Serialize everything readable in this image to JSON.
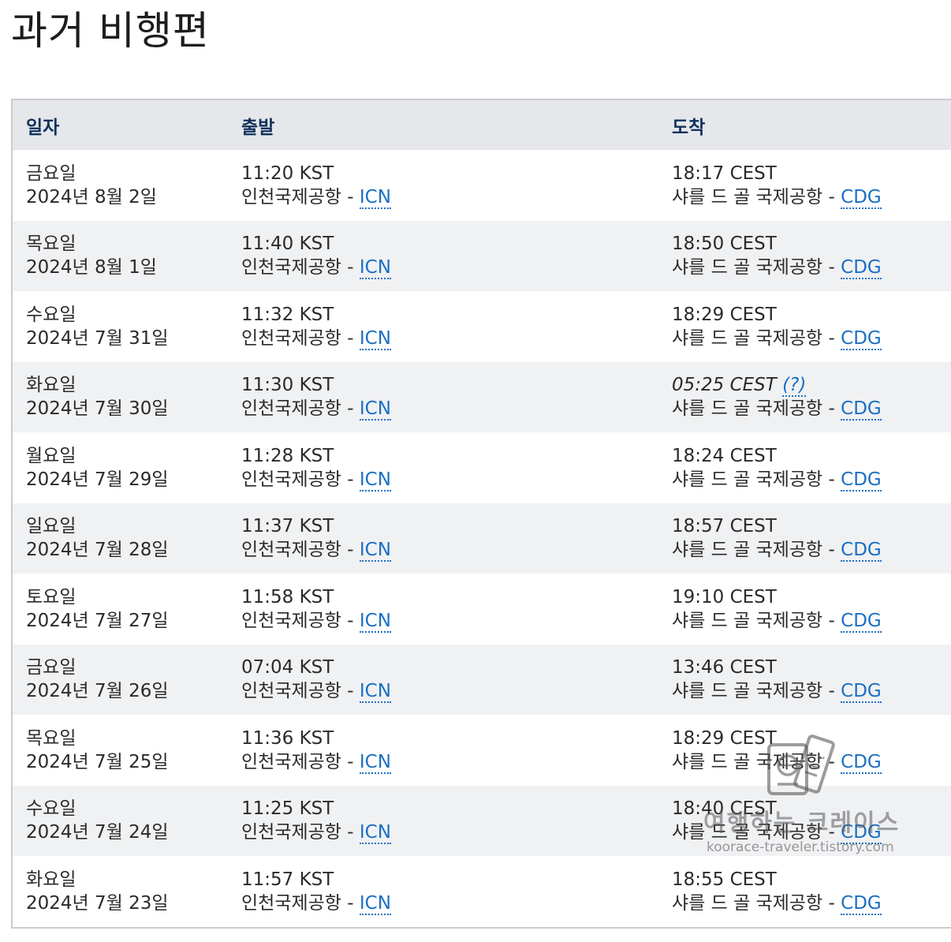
{
  "page_title": "과거 비행편",
  "columns": {
    "date": "일자",
    "departure": "출발",
    "arrival": "도착"
  },
  "rows": [
    {
      "weekday": "금요일",
      "date": "2024년 8월 2일",
      "dep_time": "11:20 KST",
      "dep_airport": "인천국제공항 - ",
      "dep_code": "ICN",
      "arr_time": "18:17 CEST",
      "arr_estimated": false,
      "arr_airport": "샤를 드 골 국제공항 - ",
      "arr_code": "CDG"
    },
    {
      "weekday": "목요일",
      "date": "2024년 8월 1일",
      "dep_time": "11:40 KST",
      "dep_airport": "인천국제공항 - ",
      "dep_code": "ICN",
      "arr_time": "18:50 CEST",
      "arr_estimated": false,
      "arr_airport": "샤를 드 골 국제공항 - ",
      "arr_code": "CDG"
    },
    {
      "weekday": "수요일",
      "date": "2024년 7월 31일",
      "dep_time": "11:32 KST",
      "dep_airport": "인천국제공항 - ",
      "dep_code": "ICN",
      "arr_time": "18:29 CEST",
      "arr_estimated": false,
      "arr_airport": "샤를 드 골 국제공항 - ",
      "arr_code": "CDG"
    },
    {
      "weekday": "화요일",
      "date": "2024년 7월 30일",
      "dep_time": "11:30 KST",
      "dep_airport": "인천국제공항 - ",
      "dep_code": "ICN",
      "arr_time": "05:25 CEST",
      "arr_estimated": true,
      "arr_help": "(?)",
      "arr_airport": "샤를 드 골 국제공항 - ",
      "arr_code": "CDG"
    },
    {
      "weekday": "월요일",
      "date": "2024년 7월 29일",
      "dep_time": "11:28 KST",
      "dep_airport": "인천국제공항 - ",
      "dep_code": "ICN",
      "arr_time": "18:24 CEST",
      "arr_estimated": false,
      "arr_airport": "샤를 드 골 국제공항 - ",
      "arr_code": "CDG"
    },
    {
      "weekday": "일요일",
      "date": "2024년 7월 28일",
      "dep_time": "11:37 KST",
      "dep_airport": "인천국제공항 - ",
      "dep_code": "ICN",
      "arr_time": "18:57 CEST",
      "arr_estimated": false,
      "arr_airport": "샤를 드 골 국제공항 - ",
      "arr_code": "CDG"
    },
    {
      "weekday": "토요일",
      "date": "2024년 7월 27일",
      "dep_time": "11:58 KST",
      "dep_airport": "인천국제공항 - ",
      "dep_code": "ICN",
      "arr_time": "19:10 CEST",
      "arr_estimated": false,
      "arr_airport": "샤를 드 골 국제공항 - ",
      "arr_code": "CDG"
    },
    {
      "weekday": "금요일",
      "date": "2024년 7월 26일",
      "dep_time": "07:04 KST",
      "dep_airport": "인천국제공항 - ",
      "dep_code": "ICN",
      "arr_time": "13:46 CEST",
      "arr_estimated": false,
      "arr_airport": "샤를 드 골 국제공항 - ",
      "arr_code": "CDG"
    },
    {
      "weekday": "목요일",
      "date": "2024년 7월 25일",
      "dep_time": "11:36 KST",
      "dep_airport": "인천국제공항 - ",
      "dep_code": "ICN",
      "arr_time": "18:29 CEST",
      "arr_estimated": false,
      "arr_airport": "샤를 드 골 국제공항 - ",
      "arr_code": "CDG"
    },
    {
      "weekday": "수요일",
      "date": "2024년 7월 24일",
      "dep_time": "11:25 KST",
      "dep_airport": "인천국제공항 - ",
      "dep_code": "ICN",
      "arr_time": "18:40 CEST",
      "arr_estimated": false,
      "arr_airport": "샤를 드 골 국제공항 - ",
      "arr_code": "CDG"
    },
    {
      "weekday": "화요일",
      "date": "2024년 7월 23일",
      "dep_time": "11:57 KST",
      "dep_airport": "인천국제공항 - ",
      "dep_code": "ICN",
      "arr_time": "18:55 CEST",
      "arr_estimated": false,
      "arr_airport": "샤를 드 골 국제공항 - ",
      "arr_code": "CDG"
    }
  ],
  "watermark": {
    "name": "여행하는 크레이스",
    "url": "koorace-traveler.tistory.com",
    "icon": "passport-ticket-icon"
  },
  "colors": {
    "link": "#1a6fc4",
    "header_text": "#10315c",
    "header_bg": "#e5e7ea",
    "alt_row_bg": "#f0f1f3"
  }
}
